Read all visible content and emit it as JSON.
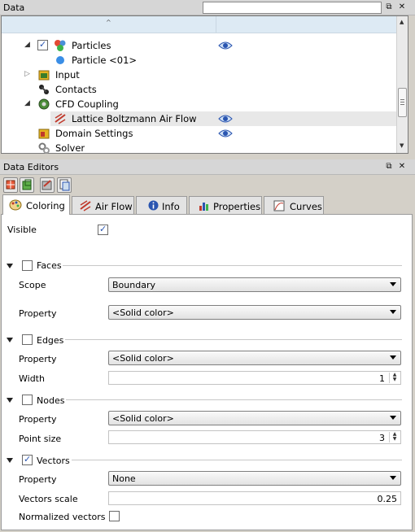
{
  "data_panel": {
    "title": "Data",
    "search_placeholder": "",
    "float_icon": "⧉",
    "close_icon": "✕",
    "tree": [
      {
        "label": "Particles",
        "checked": true,
        "eye": true
      },
      {
        "label": "Particle <01>"
      },
      {
        "label": "Input"
      },
      {
        "label": "Contacts"
      },
      {
        "label": "CFD Coupling"
      },
      {
        "label": "Lattice Boltzmann Air Flow",
        "eye": true,
        "selected": true
      },
      {
        "label": "Domain Settings",
        "eye": true
      },
      {
        "label": "Solver"
      }
    ]
  },
  "editors_panel": {
    "title": "Data Editors",
    "tabs": [
      "Coloring",
      "Air Flow",
      "Info",
      "Properties",
      "Curves"
    ],
    "active_tab": "Coloring"
  },
  "coloring": {
    "visible_label": "Visible",
    "faces": {
      "label": "Faces",
      "scope_label": "Scope",
      "scope_value": "Boundary",
      "property_label": "Property",
      "property_value": "<Solid color>"
    },
    "edges": {
      "label": "Edges",
      "property_label": "Property",
      "property_value": "<Solid color>",
      "width_label": "Width",
      "width_value": "1"
    },
    "nodes": {
      "label": "Nodes",
      "property_label": "Property",
      "property_value": "<Solid color>",
      "point_size_label": "Point size",
      "point_size_value": "3"
    },
    "vectors": {
      "label": "Vectors",
      "property_label": "Property",
      "property_value": "None",
      "scale_label": "Vectors scale",
      "scale_value": "0.25",
      "normalized_label": "Normalized vectors"
    }
  },
  "colors": {
    "accent": "#2a55b0",
    "selection": "#e8e8e8",
    "header": "#d6d6d6"
  }
}
